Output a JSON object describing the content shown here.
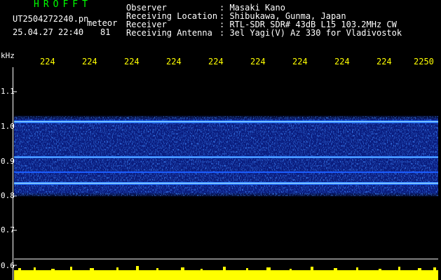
{
  "header": {
    "app_title": "HROFFT",
    "filename": "UT2504272240.pn",
    "fname_suffix": "meteor",
    "datetime": "25.04.27 22:40",
    "value": "81"
  },
  "info": [
    {
      "label": "Observer",
      "value": ": Masaki Kano"
    },
    {
      "label": "Receiving Location",
      "value": ": Shibukawa, Gunma, Japan"
    },
    {
      "label": "Receiver",
      "value": ": RTL-SDR SDR# 43dB L15 103.2MHz CW"
    },
    {
      "label": "Receiving Antenna",
      "value": ": 3el Yagi(V) Az 330 for Vladivostok"
    }
  ],
  "axis": {
    "y_unit": "kHz",
    "y_ticks": [
      "1.1",
      "1.0",
      "0.9",
      "0.8",
      "0.7",
      "0.6"
    ],
    "x_ticks": [
      "224",
      "224",
      "224",
      "224",
      "224",
      "224",
      "224",
      "224",
      "224",
      "2250"
    ]
  },
  "colors": {
    "axis": "#ffffff",
    "label_yellow": "#ffff00",
    "title_green": "#00ff00",
    "band_blue": "#0a2cff"
  }
}
